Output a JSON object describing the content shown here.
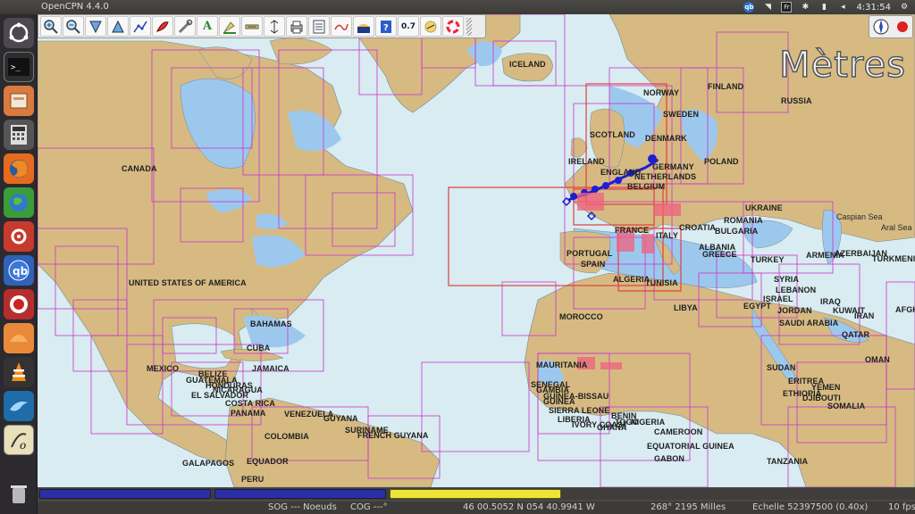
{
  "window": {
    "title": "OpenCPN 4.4.0"
  },
  "clock": "4:31:54",
  "tray": {
    "qb": "qb",
    "fr": "Fr"
  },
  "colors": {
    "land": "#d6ba82",
    "sea": "#d8ecf1",
    "shallow": "#9dc8ee",
    "chart_outline": "#cc33cc",
    "active_chart": "#e04040",
    "route": "#1e1ed2",
    "piano_blue": "#2b2fa6",
    "piano_yellow": "#ede43a"
  },
  "toolbar": {
    "buttons": [
      "zoom-in-icon",
      "zoom-out-icon",
      "scale-in-icon",
      "scale-out-icon",
      "route-icon",
      "mob-icon",
      "tools-icon",
      "text-icon",
      "tide-icon",
      "settings-icon",
      "distance-icon",
      "print-icon",
      "route-manager-icon",
      "track-icon",
      "color-scheme-icon",
      "help-icon",
      "zoom-level-icon",
      "weather-icon",
      "life-ring-icon"
    ],
    "zoom_level": "0.7",
    "text_label": "A"
  },
  "overlay": {
    "units": "Mètres"
  },
  "labels": {
    "countries": [
      "ICELAND",
      "NORWAY",
      "FINLAND",
      "RUSSIA",
      "SWEDEN",
      "SCOTLAND",
      "DENMARK",
      "IRELAND",
      "GERMANY",
      "POLAND",
      "ENGLAND",
      "NETHERLANDS",
      "BELGIUM",
      "CANADA",
      "UKRAINE",
      "ROMANIA",
      "BULGARIA",
      "FRANCE",
      "CROATIA",
      "ITALY",
      "ALBANIA",
      "GREECE",
      "TURKEY",
      "ARMENIA",
      "AZERBAIJAN",
      "TURKMENIS",
      "PORTUGAL",
      "SPAIN",
      "ALGERIA",
      "TUNISIA",
      "UNITED STATES OF AMERICA",
      "SYRIA",
      "LEBANON",
      "ISRAEL",
      "JORDAN",
      "IRAQ",
      "IRAN",
      "KUWAIT",
      "AFGHA",
      "BAHAMAS",
      "LIBYA",
      "EGYPT",
      "MOROCCO",
      "SAUDI ARABIA",
      "QATAR",
      "CUBA",
      "MEXICO",
      "JAMAICA",
      "BELIZE",
      "GUATEMALA",
      "HONDURAS",
      "NICARAGUA",
      "EL SALVADOR",
      "COSTA RICA",
      "PANAMA",
      "VENEZUELA",
      "GUYANA",
      "SURINAME",
      "FRENCH GUYANA",
      "COLOMBIA",
      "GALAPAGOS",
      "EQUADOR",
      "PERU",
      "MAURITANIA",
      "SENEGAL",
      "GAMBIA",
      "GUINEA-BISSAU",
      "GUINEA",
      "SIERRA LEONE",
      "LIBERIA",
      "IVORY COAST",
      "GHANA",
      "BENIN",
      "TOGO",
      "NIGERIA",
      "CAMEROON",
      "EQUATORIAL GUINEA",
      "GABON",
      "SUDAN",
      "ERITREA",
      "ETHIOPIA",
      "YEMEN",
      "DJIBOUTI",
      "SOMALIA",
      "OMAN",
      "TANZANIA"
    ],
    "seas": [
      "Caspian Sea",
      "Aral Sea"
    ]
  },
  "status": {
    "sog": "SOG --- Noeuds",
    "cog": "COG ---°",
    "position": "46 00.5052 N    054 40.9941 W",
    "bearing_distance": "268°  2195 Milles",
    "scale": "Echelle  52397500 (0.40x)",
    "fps": "10 fps"
  },
  "piano": {
    "keys": 3,
    "colors": [
      "blue",
      "blue",
      "yellow"
    ]
  }
}
